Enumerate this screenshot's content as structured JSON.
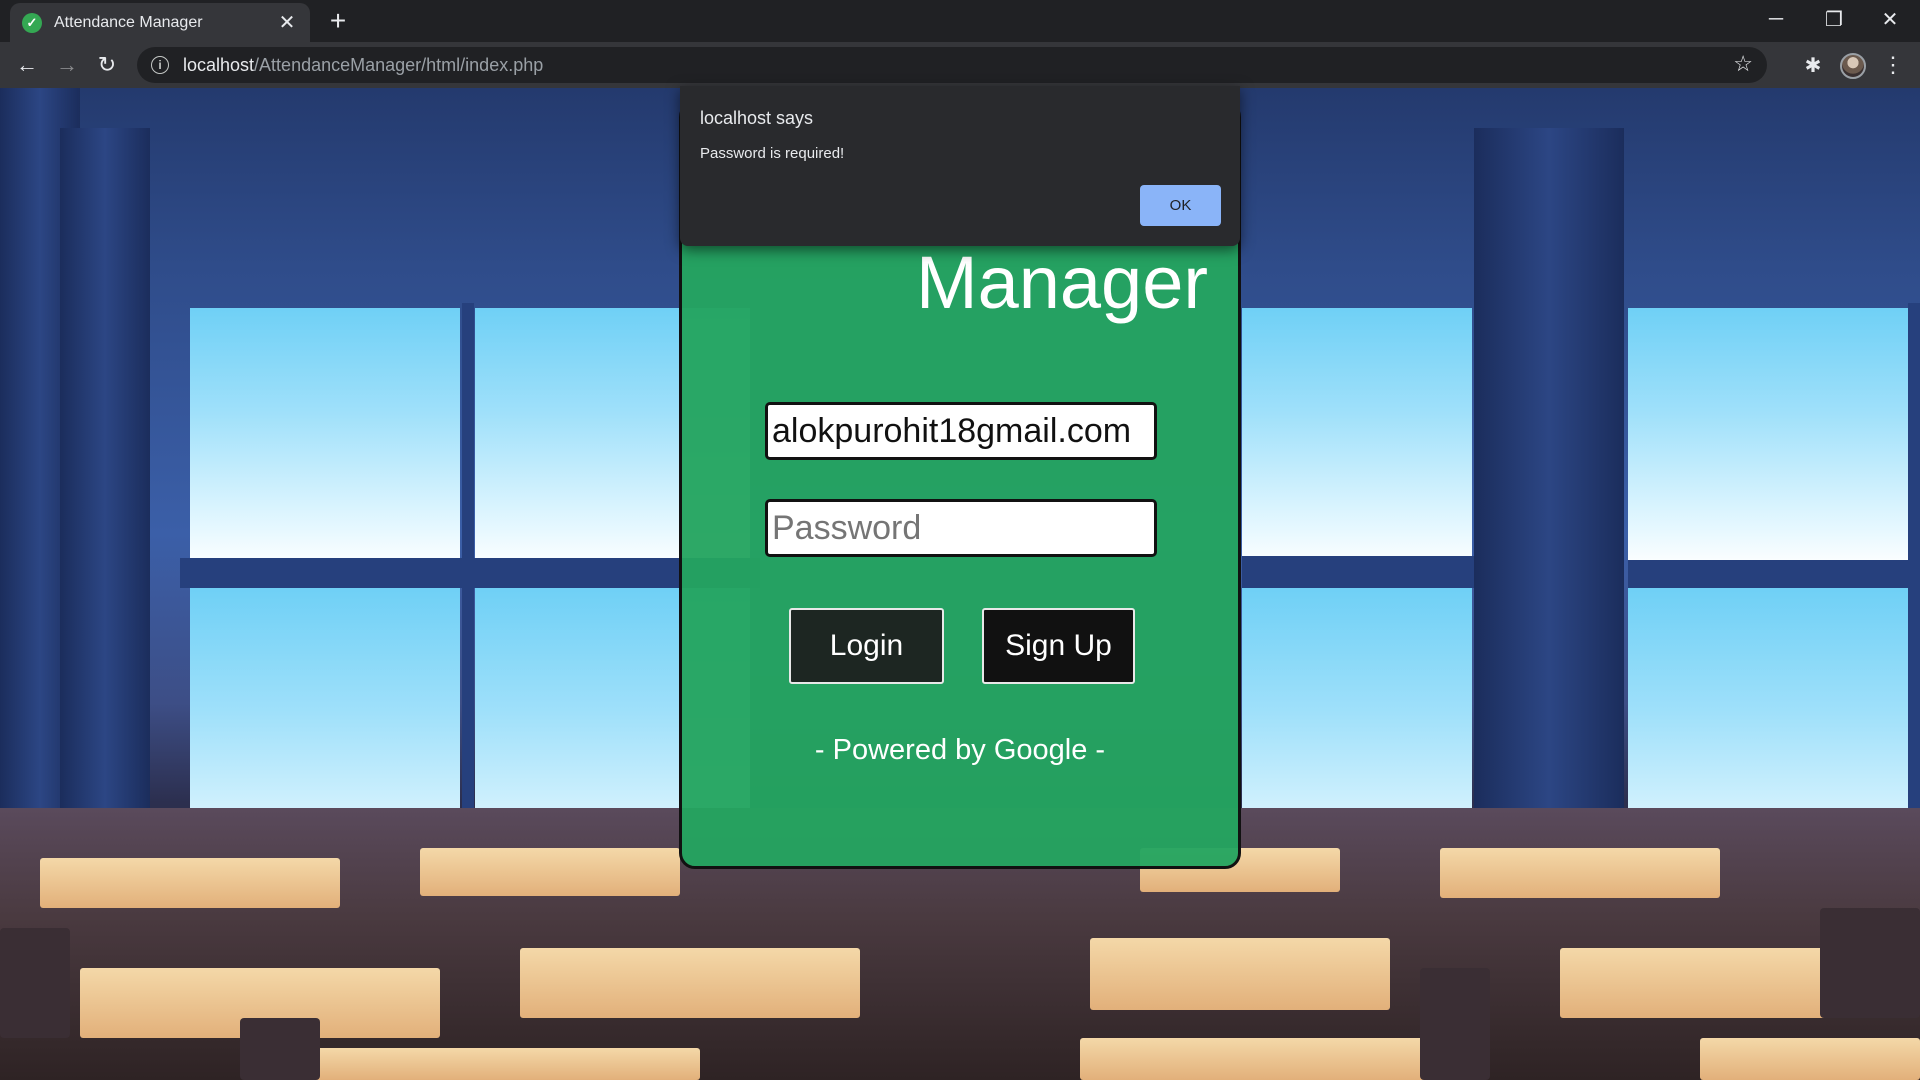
{
  "browser": {
    "tab": {
      "title": "Attendance Manager",
      "favicon": "check-circle-icon",
      "close": "✕"
    },
    "new_tab": "+",
    "window_controls": {
      "minimize": "─",
      "restore": "❐",
      "close": "✕"
    },
    "nav": {
      "back": "←",
      "forward": "→",
      "reload": "↻"
    },
    "address": {
      "host": "localhost",
      "path": "/AttendanceManager/html/index.php"
    },
    "icons": {
      "info": "i",
      "star": "☆",
      "extensions": "✱",
      "menu": "⋮"
    }
  },
  "page": {
    "heading": "Manager",
    "email_value": "alokpurohit18gmail.com",
    "password_placeholder": "Password",
    "login_label": "Login",
    "signup_label": "Sign Up",
    "powered_by": "- Powered by Google -",
    "card_color": "#24a460"
  },
  "dialog": {
    "title": "localhost says",
    "message": "Password is required!",
    "ok_label": "OK",
    "ok_color": "#8ab4f8"
  }
}
